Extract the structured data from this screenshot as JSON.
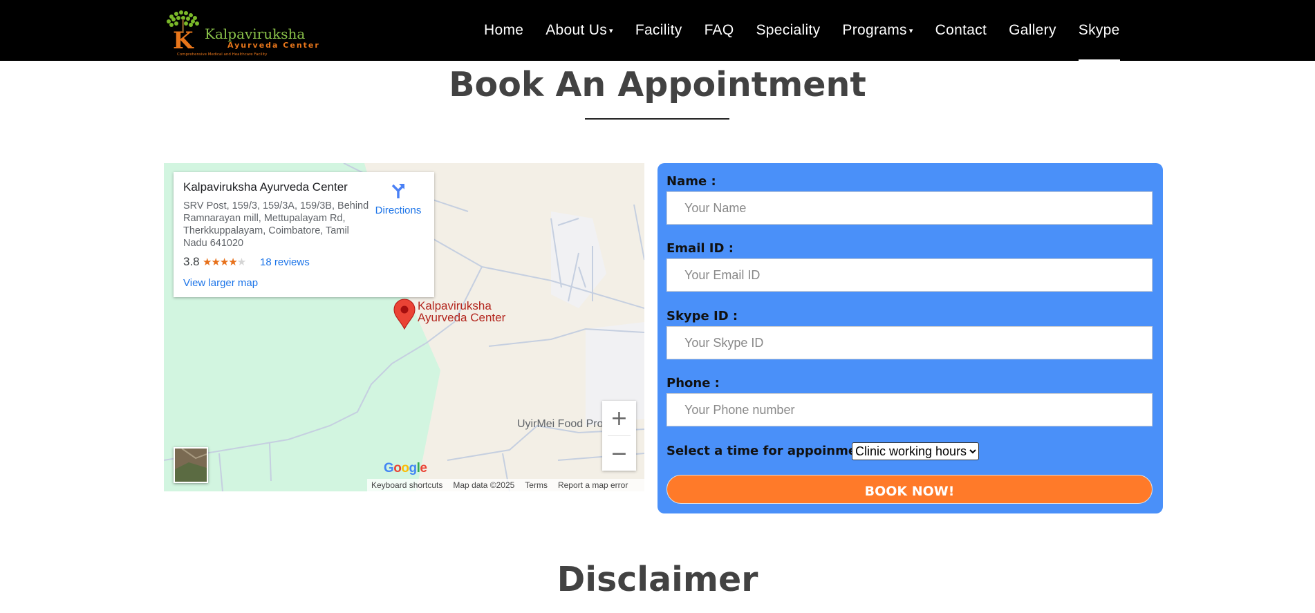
{
  "nav": {
    "logo": {
      "name": "Kalpaviruksha",
      "tagline": "Ayurveda Center",
      "sub": "Comprehensive Medical and Healthcare Facility"
    },
    "items": [
      {
        "label": "Home"
      },
      {
        "label": "About Us",
        "dropdown": true
      },
      {
        "label": "Facility"
      },
      {
        "label": "FAQ"
      },
      {
        "label": "Speciality"
      },
      {
        "label": "Programs",
        "dropdown": true
      },
      {
        "label": "Contact"
      },
      {
        "label": "Gallery"
      },
      {
        "label": "Skype",
        "active": true
      }
    ],
    "caret": "▾"
  },
  "appointment": {
    "title": "Book An Appointment"
  },
  "map": {
    "place_name": "Kalpaviruksha Ayurveda Center",
    "address": "SRV Post, 159/3, 159/3A, 159/3B, Behind Ramnarayan mill, Mettupalayam Rd, Therkkuppalayam, Coimbatore, Tamil Nadu 641020",
    "rating": "3.8",
    "rating_value": 3.8,
    "reviews": "18 reviews",
    "view_larger": "View larger map",
    "directions": "Directions",
    "marker_label_1": "Kalpaviruksha",
    "marker_label_2": "Ayurveda Center",
    "poi": "UyirMei Food Products",
    "zoom_in": "+",
    "zoom_out": "−",
    "google": "Google",
    "attribution": {
      "shortcuts": "Keyboard shortcuts",
      "data": "Map data ©2025",
      "terms": "Terms",
      "report": "Report a map error"
    }
  },
  "form": {
    "name_label": "Name :",
    "name_placeholder": "Your Name",
    "email_label": "Email ID :",
    "email_placeholder": "Your Email ID",
    "skype_label": "Skype ID :",
    "skype_placeholder": "Your Skype ID",
    "phone_label": "Phone :",
    "phone_placeholder": "Your Phone number",
    "time_label": "Select a time for appoinment :",
    "time_selected": "Clinic working hours",
    "submit": "BOOK NOW!"
  },
  "disclaimer": {
    "title": "Disclaimer"
  },
  "colors": {
    "nav_bg": "#000000",
    "form_bg": "#4a90f9",
    "button": "#ff7a29",
    "heading": "#424242",
    "link": "#1a73e8",
    "marker": "#ea4335"
  }
}
